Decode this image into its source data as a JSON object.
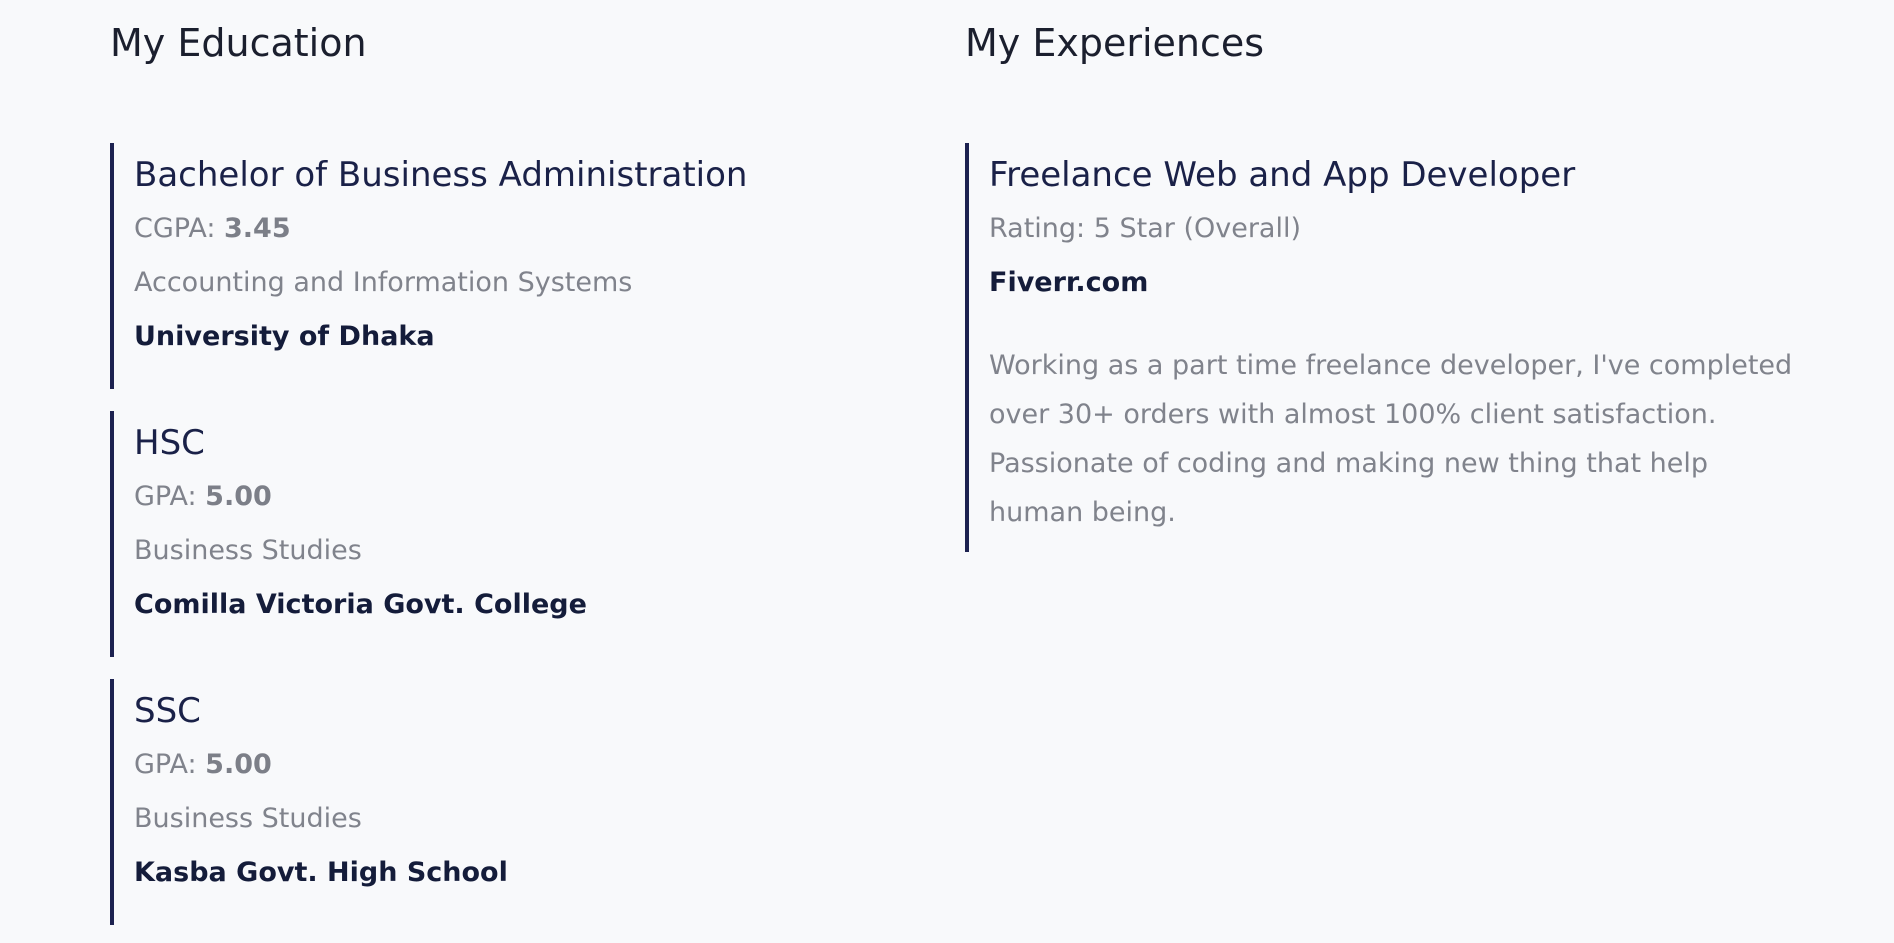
{
  "education": {
    "title": "My Education",
    "items": [
      {
        "degree": "Bachelor of Business Administration",
        "score_label": "CGPA: ",
        "score_value": "3.45",
        "field": "Accounting and Information Systems",
        "institution": "University of Dhaka"
      },
      {
        "degree": "HSC",
        "score_label": "GPA: ",
        "score_value": "5.00",
        "field": "Business Studies",
        "institution": "Comilla Victoria Govt. College"
      },
      {
        "degree": "SSC",
        "score_label": "GPA: ",
        "score_value": "5.00",
        "field": "Business Studies",
        "institution": "Kasba Govt. High School"
      }
    ]
  },
  "experience": {
    "title": "My Experiences",
    "items": [
      {
        "role": "Freelance Web and App Developer",
        "rating": "Rating: 5 Star (Overall)",
        "company": "Fiverr.com",
        "description": "Working as a part time freelance developer, I've completed over 30+ orders with almost 100% client satisfaction. Passionate of coding and making new thing that help human being."
      }
    ]
  },
  "colors": {
    "background": "#f8f9fb",
    "accent_border": "#1d2250",
    "heading": "#1a2148",
    "muted_text": "#80838c"
  }
}
